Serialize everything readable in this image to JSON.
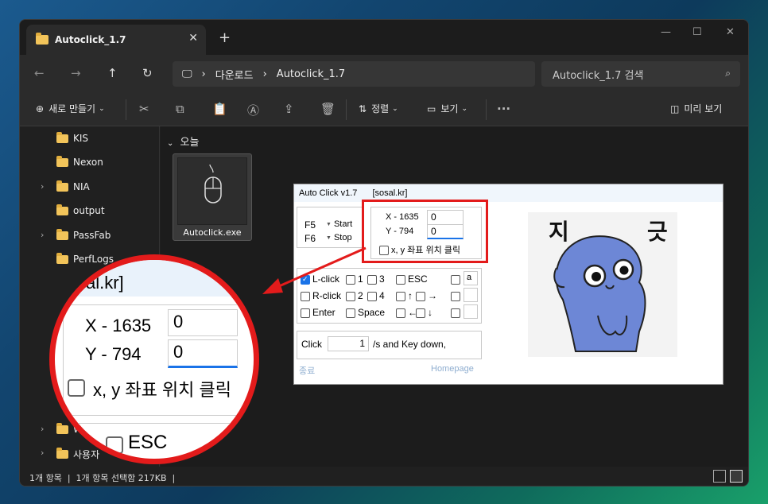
{
  "window": {
    "tab_title": "Autoclick_1.7",
    "breadcrumb": [
      "다운로드",
      "Autoclick_1.7"
    ],
    "search_placeholder": "Autoclick_1.7 검색"
  },
  "commands": {
    "new": "새로 만들기",
    "sort": "정렬",
    "view": "보기",
    "preview": "미리 보기"
  },
  "sidebar": {
    "items": [
      {
        "label": "KIS",
        "expandable": false
      },
      {
        "label": "Nexon",
        "expandable": false
      },
      {
        "label": "NIA",
        "expandable": true
      },
      {
        "label": "output",
        "expandable": false
      },
      {
        "label": "PassFab",
        "expandable": true
      },
      {
        "label": "PerfLogs",
        "expandable": false
      },
      {
        "label": "Wi",
        "expandable": true
      },
      {
        "label": "사용자",
        "expandable": true
      }
    ]
  },
  "content": {
    "group_header": "오늘",
    "file_name": "Autoclick.exe"
  },
  "status": {
    "text": "1개 항목  |  1개 항목 선택함 217KB  |"
  },
  "app": {
    "title": "Auto Click v1.7",
    "site": "[sosal.kr]",
    "f5": "F5",
    "f6": "F6",
    "start": "Start",
    "stop": "Stop",
    "x_label": "X - 1635",
    "y_label": "Y - 794",
    "x_value": "0",
    "y_value": "0",
    "xy_click": "x, y 좌표 위치 클릭",
    "lclick": "L-click",
    "rclick": "R-click",
    "enter": "Enter",
    "space": "Space",
    "n1": "1",
    "n2": "2",
    "n3": "3",
    "n4": "4",
    "esc": "ESC",
    "up": "↑",
    "right": "→",
    "left": "←",
    "down": "↓",
    "a_key": "a",
    "click_label": "Click",
    "click_value": "1",
    "per_sec": "/s  and Key down,",
    "exit": "종료",
    "homepage": "Homepage",
    "sticker_text_1": "지",
    "sticker_text_2": "긋"
  },
  "magnifier": {
    "site": "sal.kr]",
    "x_label": "X - 1635",
    "y_label": "Y - 794",
    "x_value": "0",
    "y_value": "0",
    "xy_click": "x, y 좌표 위치 클릭",
    "esc": "ESC"
  },
  "colors": {
    "highlight": "#e31b1b",
    "checkbox_checked": "#1a73e8",
    "sticker_character": "#6d87d6"
  }
}
